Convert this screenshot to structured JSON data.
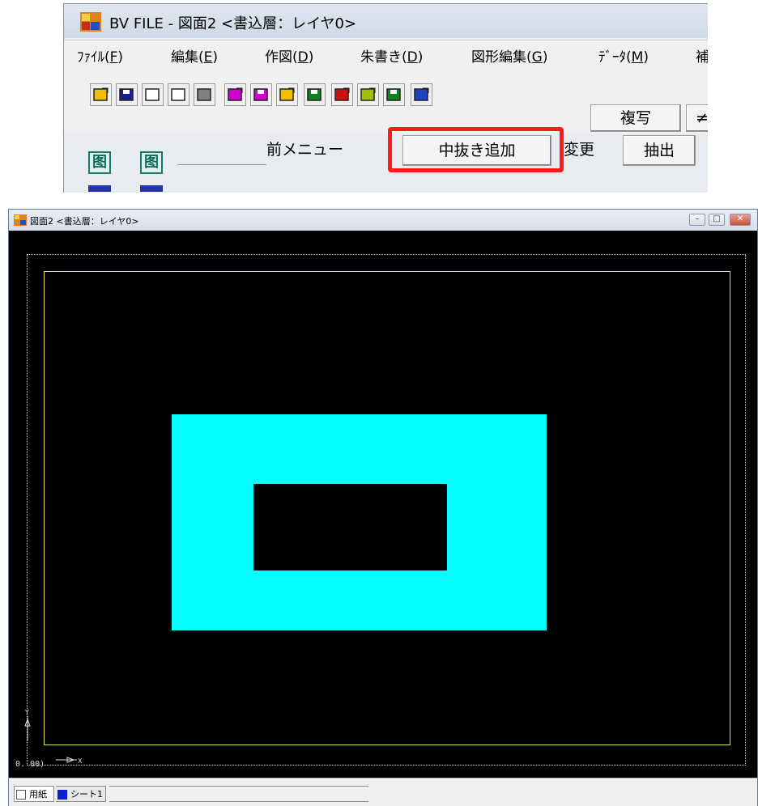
{
  "app": {
    "title": "BV FILE - 図面2 <書込層：レイヤ0>",
    "menu": [
      {
        "label": "ﾌｧｲﾙ(",
        "key": "F",
        "suffix": ")"
      },
      {
        "label": "編集(",
        "key": "E",
        "suffix": ")"
      },
      {
        "label": "作図(",
        "key": "D",
        "suffix": ")"
      },
      {
        "label": "朱書き(",
        "key": "D",
        "suffix": ")"
      },
      {
        "label": "図形編集(",
        "key": "G",
        "suffix": ")"
      },
      {
        "label": "ﾃﾞｰﾀ(",
        "key": "M",
        "suffix": ")"
      },
      {
        "label": "補",
        "key": "",
        "suffix": ""
      }
    ],
    "toolbar_icons": [
      "open-folder-icon",
      "save-icon",
      "new-page-icon",
      "copy-page-icon",
      "print-icon",
      "open-magenta-icon",
      "save-magenta-icon",
      "open-yellow-icon",
      "save-green-icon",
      "open-red-icon",
      "open-yellowgreen-icon",
      "save-green2-icon",
      "open-blue-icon"
    ],
    "toolbar_icon_colors": [
      "#f0c000",
      "#1a1a8a",
      "#ffffff",
      "#ffffff",
      "#808080",
      "#d000d0",
      "#d000d0",
      "#f0c000",
      "#108020",
      "#d01010",
      "#a0c000",
      "#108020",
      "#2040c0"
    ],
    "copy_button": "複写",
    "next_button_partial": "≠",
    "buttons": {
      "prev_menu": "前メニュー",
      "add_cutout": "中抜き追加",
      "change": "変更",
      "extract": "抽出"
    },
    "side_icon_glyph": "图"
  },
  "drawing_window": {
    "title": "図面2 <書込層：レイヤ0>",
    "controls": {
      "minimize": "–",
      "maximize": "□",
      "close": "✕"
    },
    "coord_label": "0. 00)",
    "tabs": {
      "paper": "用紙",
      "sheet": "シート1"
    },
    "colors": {
      "background": "#000000",
      "filled_shape": "#00ffff",
      "sheet_frame": "#e8e850",
      "paper_frame": "#cccccc",
      "sheet_tab_swatch": "#1020d0"
    }
  }
}
